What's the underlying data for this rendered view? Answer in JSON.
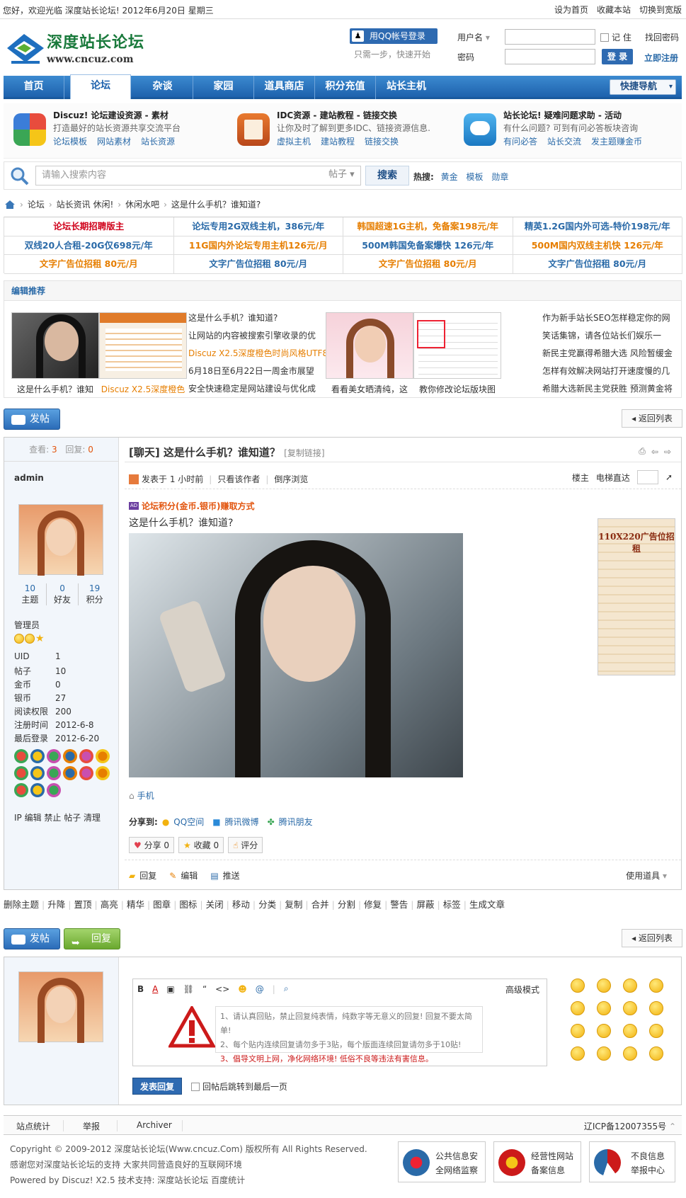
{
  "topbar": {
    "welcome": "您好，欢迎光临 深度站长论坛! 2012年6月20日 星期三",
    "links": [
      "设为首页",
      "收藏本站",
      "切换到宽版"
    ]
  },
  "logo": {
    "cn": "深度站长论坛",
    "url": "www.cncuz.com"
  },
  "login": {
    "qq_btn": "用QQ帐号登录",
    "qq_tip": "只需一步，快速开始",
    "user_label": "用户名",
    "pass_label": "密码",
    "remember": "记 住",
    "find_pw": "找回密码",
    "submit": "登 录",
    "register": "立即注册"
  },
  "nav": {
    "items": [
      "首页",
      "论坛",
      "杂谈",
      "家园",
      "道具商店",
      "积分充值",
      "站长主机"
    ],
    "active": "论坛",
    "quick": "快捷导航"
  },
  "features": [
    {
      "title": "Discuz! 论坛建设资源 - 素材",
      "desc": "打造最好的站长资源共享交流平台",
      "links": [
        "论坛模板",
        "网站素材",
        "站长资源"
      ]
    },
    {
      "title": "IDC资源 - 建站教程 - 链接交换",
      "desc": "让你及时了解到更多IDC、链接资源信息.",
      "links": [
        "虚拟主机",
        "建站教程",
        "链接交换"
      ]
    },
    {
      "title": "站长论坛! 疑难问题求助 - 活动",
      "desc": "有什么问题? 可到有问必答板块咨询",
      "links": [
        "有问必答",
        "站长交流",
        "发主题赚金币"
      ]
    }
  ],
  "search": {
    "placeholder": "请输入搜索内容",
    "type": "帖子",
    "button": "搜索",
    "hot_label": "热搜:",
    "hot": [
      "黄金",
      "模板",
      "勋章"
    ]
  },
  "breadcrumb": [
    "论坛",
    "站长资讯 休闲!",
    "休闲水吧",
    "这是什么手机？谁知道?"
  ],
  "ads": [
    [
      "论坛长期招聘版主",
      "论坛专用2G双线主机，386元/年",
      "韩国超速1G主机，免备案198元/年",
      "精英1.2G国内外可选-特价198元/年"
    ],
    [
      "双线20人合租-20G仅698元/年",
      "11G国内外论坛专用主机126元/月",
      "500M韩国免备案爆快 126元/年",
      "500M国内双线主机快 126元/年"
    ],
    [
      "文字广告位招租 80元/月",
      "文字广告位招租 80元/月",
      "文字广告位招租 80元/月",
      "文字广告位招租 80元/月"
    ]
  ],
  "ad_colors": [
    [
      "#d0021b",
      "#2a6aa8",
      "#e67e00",
      "#2a6aa8"
    ],
    [
      "#2a6aa8",
      "#e67e00",
      "#2a6aa8",
      "#e67e00"
    ],
    [
      "#e67e00",
      "#2a6aa8",
      "#e67e00",
      "#2a6aa8"
    ]
  ],
  "picks": {
    "title": "编辑推荐",
    "captions": [
      "这是什么手机？谁知",
      "Discuz X2.5深度橙色",
      "看看美女晒清纯，这",
      "教你修改论坛版块图"
    ],
    "list1": [
      "这是什么手机？谁知道?",
      "让网站的内容被搜索引擎收录的优",
      "Discuz X2.5深度橙色时尚风格UTF8",
      "6月18日至6月22日一周金市展望",
      "安全快速稳定是网站建设与优化成"
    ],
    "list2": [
      "作为新手站长SEO怎样稳定你的网",
      "笑话集锦，请各位站长们娱乐一",
      "新民主党赢得希腊大选 风险暂缓金",
      "怎样有效解决网站打开速度慢的几",
      "希腊大选新民主党获胜 预测黄金将"
    ]
  },
  "buttons": {
    "post": "发帖",
    "reply": "回复",
    "back": "返回列表"
  },
  "thread": {
    "views_label": "查看:",
    "views": "3",
    "replies_label": "回复:",
    "replies": "0",
    "title": "[聊天] 这是什么手机？谁知道？",
    "copy": "[复制链接]",
    "posted": "发表于 1 小时前",
    "only_author": "只看该作者",
    "reverse": "倒序浏览",
    "floor": "楼主",
    "elevator": "电梯直达",
    "promo": "论坛积分(金币.银币)赚取方式",
    "body": "这是什么手机？谁知道?",
    "side_ad": "110X220广告位招租",
    "tag": "手机",
    "share_label": "分享到:",
    "share": [
      "QQ空间",
      "腾讯微博",
      "腾讯朋友"
    ],
    "actions": [
      "分享 0",
      "收藏 0",
      "评分"
    ],
    "bottom": [
      "回复",
      "编辑",
      "推送"
    ],
    "tools": "使用道具"
  },
  "author": {
    "name": "admin",
    "stats": [
      {
        "n": "10",
        "l": "主题"
      },
      {
        "n": "0",
        "l": "好友"
      },
      {
        "n": "19",
        "l": "积分"
      }
    ],
    "group": "管理员",
    "fields": [
      [
        "UID",
        "1"
      ],
      [
        "帖子",
        "10"
      ],
      [
        "金币",
        "0"
      ],
      [
        "银币",
        "27"
      ],
      [
        "阅读权限",
        "200"
      ],
      [
        "注册时间",
        "2012-6-8"
      ],
      [
        "最后登录",
        "2012-6-20"
      ]
    ],
    "admin_links": "IP 编辑 禁止 帖子 清理"
  },
  "ops": [
    "删除主题",
    "升降",
    "置顶",
    "高亮",
    "精华",
    "图章",
    "图标",
    "关闭",
    "移动",
    "分类",
    "复制",
    "合并",
    "分割",
    "修复",
    "警告",
    "屏蔽",
    "标签",
    "生成文章"
  ],
  "reply": {
    "advanced": "高级模式",
    "rules": [
      "1、请认真回贴，禁止回复纯表情，纯数字等无意义的回复! 回复不要太简单!",
      "2、每个贴内连续回复请勿多于3贴，每个版面连续回复请勿多于10贴!",
      "3、倡导文明上网，净化网络环境! 低俗不良等违法有害信息。"
    ],
    "submit": "发表回复",
    "jump": "回帖后跳转到最后一页"
  },
  "footer": {
    "links": [
      "站点统计",
      "举报",
      "Archiver"
    ],
    "icp": "辽ICP备12007355号",
    "copy": [
      "Copyright © 2009-2012 深度站长论坛(Www.cncuz.Com) 版权所有 All Rights Reserved.",
      "感谢您对深度站长论坛的支持 大家共同营造良好的互联网环境",
      "Powered by Discuz! X2.5  技术支持: 深度站长论坛 百度统计"
    ],
    "badges": [
      [
        "公共信息安",
        "全网络监察"
      ],
      [
        "经营性网站",
        "备案信息"
      ],
      [
        "不良信息",
        "举报中心"
      ]
    ]
  }
}
